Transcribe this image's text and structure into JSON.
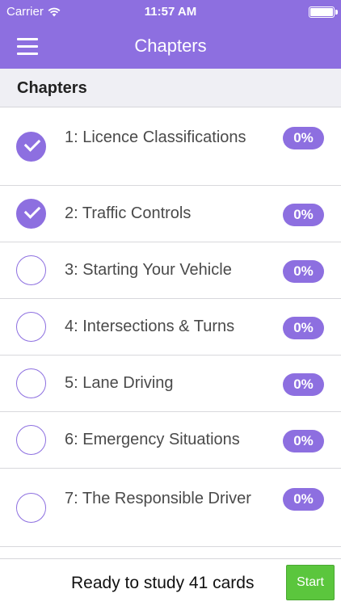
{
  "status_bar": {
    "carrier": "Carrier",
    "time": "11:57 AM",
    "wifi_icon": "wifi-icon",
    "battery_icon": "battery-icon"
  },
  "nav_bar": {
    "title": "Chapters",
    "menu_icon": "hamburger-menu-icon"
  },
  "section": {
    "title": "Chapters"
  },
  "chapters": [
    {
      "label": "1: Licence Classifications",
      "progress": "0%",
      "checked": true
    },
    {
      "label": "2: Traffic Controls",
      "progress": "0%",
      "checked": true
    },
    {
      "label": "3: Starting Your Vehicle",
      "progress": "0%",
      "checked": false
    },
    {
      "label": "4: Intersections & Turns",
      "progress": "0%",
      "checked": false
    },
    {
      "label": "5: Lane Driving",
      "progress": "0%",
      "checked": false
    },
    {
      "label": "6: Emergency Situations",
      "progress": "0%",
      "checked": false
    },
    {
      "label": "7: The Responsible Driver",
      "progress": "0%",
      "checked": false
    }
  ],
  "footer": {
    "ready_text": "Ready to study 41 cards",
    "start_label": "Start"
  },
  "colors": {
    "accent": "#8d6fe0",
    "start_button": "#5bc63d"
  }
}
